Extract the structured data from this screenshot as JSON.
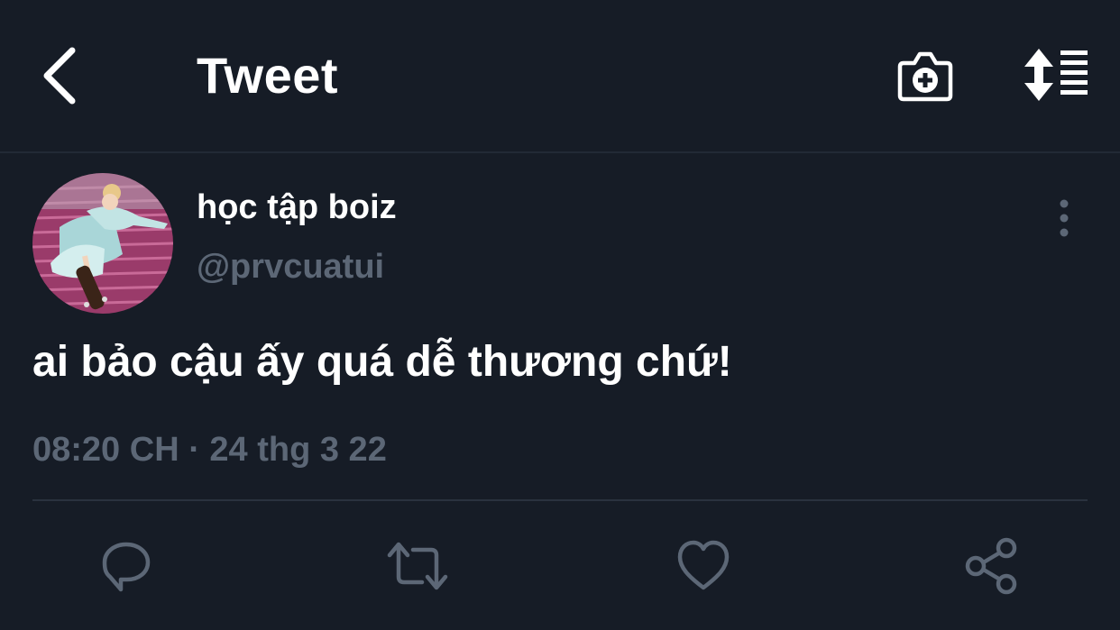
{
  "header": {
    "title": "Tweet"
  },
  "tweet": {
    "display_name": "học tập boiz",
    "handle": "@prvcuatui",
    "text": "ai bảo cậu ấy quá dễ thương chứ!",
    "timestamp": "08:20 CH · 24 thg 3 22"
  },
  "icons": {
    "back": "chevron-left-icon",
    "camera": "camera-plus-icon",
    "sort": "sort-arrows-list-icon",
    "more": "more-vertical-icon",
    "reply": "reply-icon",
    "retweet": "retweet-icon",
    "like": "heart-icon",
    "share": "share-icon"
  },
  "colors": {
    "background": "#161c26",
    "text_primary": "#ffffff",
    "text_secondary": "#5c6776",
    "icon_muted": "#5c6776",
    "divider": "#2a323e"
  }
}
